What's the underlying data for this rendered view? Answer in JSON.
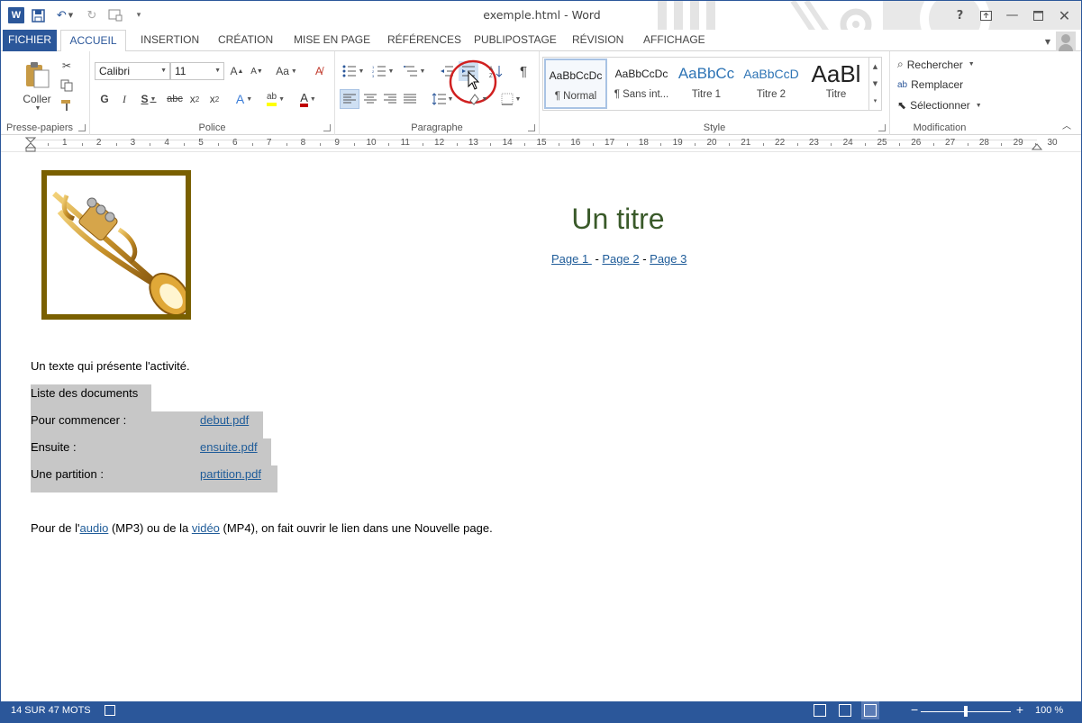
{
  "window": {
    "title": "exemple.html - Word"
  },
  "qat": {
    "undo_icon": "undo-icon",
    "redo_icon": "redo-icon"
  },
  "tabs": [
    {
      "label": "FICHIER"
    },
    {
      "label": "ACCUEIL"
    },
    {
      "label": "INSERTION"
    },
    {
      "label": "CRÉATION"
    },
    {
      "label": "MISE EN PAGE"
    },
    {
      "label": "RÉFÉRENCES"
    },
    {
      "label": "PUBLIPOSTAGE"
    },
    {
      "label": "RÉVISION"
    },
    {
      "label": "AFFICHAGE"
    }
  ],
  "ribbon": {
    "clipboard": {
      "label": "Presse-papiers",
      "paste": "Coller"
    },
    "font": {
      "label": "Police",
      "font_name": "Calibri",
      "font_size": "11",
      "change_case": "Aa"
    },
    "paragraph": {
      "label": "Paragraphe"
    },
    "styles": {
      "label": "Style",
      "items": [
        {
          "preview": "AaBbCcDc",
          "name": "¶ Normal"
        },
        {
          "preview": "AaBbCcDc",
          "name": "¶ Sans int..."
        },
        {
          "preview": "AaBbCc",
          "name": "Titre 1"
        },
        {
          "preview": "AaBbCcD",
          "name": "Titre 2"
        },
        {
          "preview": "AaBl",
          "name": "Titre"
        }
      ]
    },
    "editing": {
      "label": "Modification",
      "find": "Rechercher",
      "replace": "Remplacer",
      "select": "Sélectionner"
    }
  },
  "ruler": {
    "numbers": [
      "1",
      "2",
      "3",
      "4",
      "5",
      "6",
      "7",
      "8",
      "9",
      "10",
      "11",
      "12",
      "13",
      "14",
      "15",
      "16",
      "17",
      "18",
      "19",
      "20",
      "21",
      "22",
      "23",
      "24",
      "25",
      "26",
      "27",
      "28",
      "29",
      "30"
    ]
  },
  "document": {
    "heading": "Un titre",
    "nav": [
      {
        "text": "Page 1 "
      },
      {
        "text": "Page 2"
      },
      {
        "text": "Page 3"
      }
    ],
    "nav_sep": " - ",
    "intro": "Un texte qui présente l'activité.",
    "table": {
      "title": "Liste des documents",
      "rows": [
        {
          "label": "Pour commencer :",
          "link": "debut.pdf"
        },
        {
          "label": "Ensuite :",
          "link": "ensuite.pdf"
        },
        {
          "label": "Une partition :",
          "link": "partition.pdf"
        }
      ]
    },
    "footer": {
      "part1": "Pour de l'",
      "link1": "audio",
      "part2": " (MP3) ou de la ",
      "link2": "vidéo",
      "part3": " (MP4), on fait ouvrir le lien dans une Nouvelle page."
    }
  },
  "status": {
    "words": "14 SUR 47 MOTS",
    "zoom": "100 %"
  },
  "colors": {
    "accent": "#2b579a",
    "heading": "#3a5a2a",
    "link": "#1f5c99",
    "frame": "#7a6000",
    "highlight": "#c7c7c7"
  }
}
